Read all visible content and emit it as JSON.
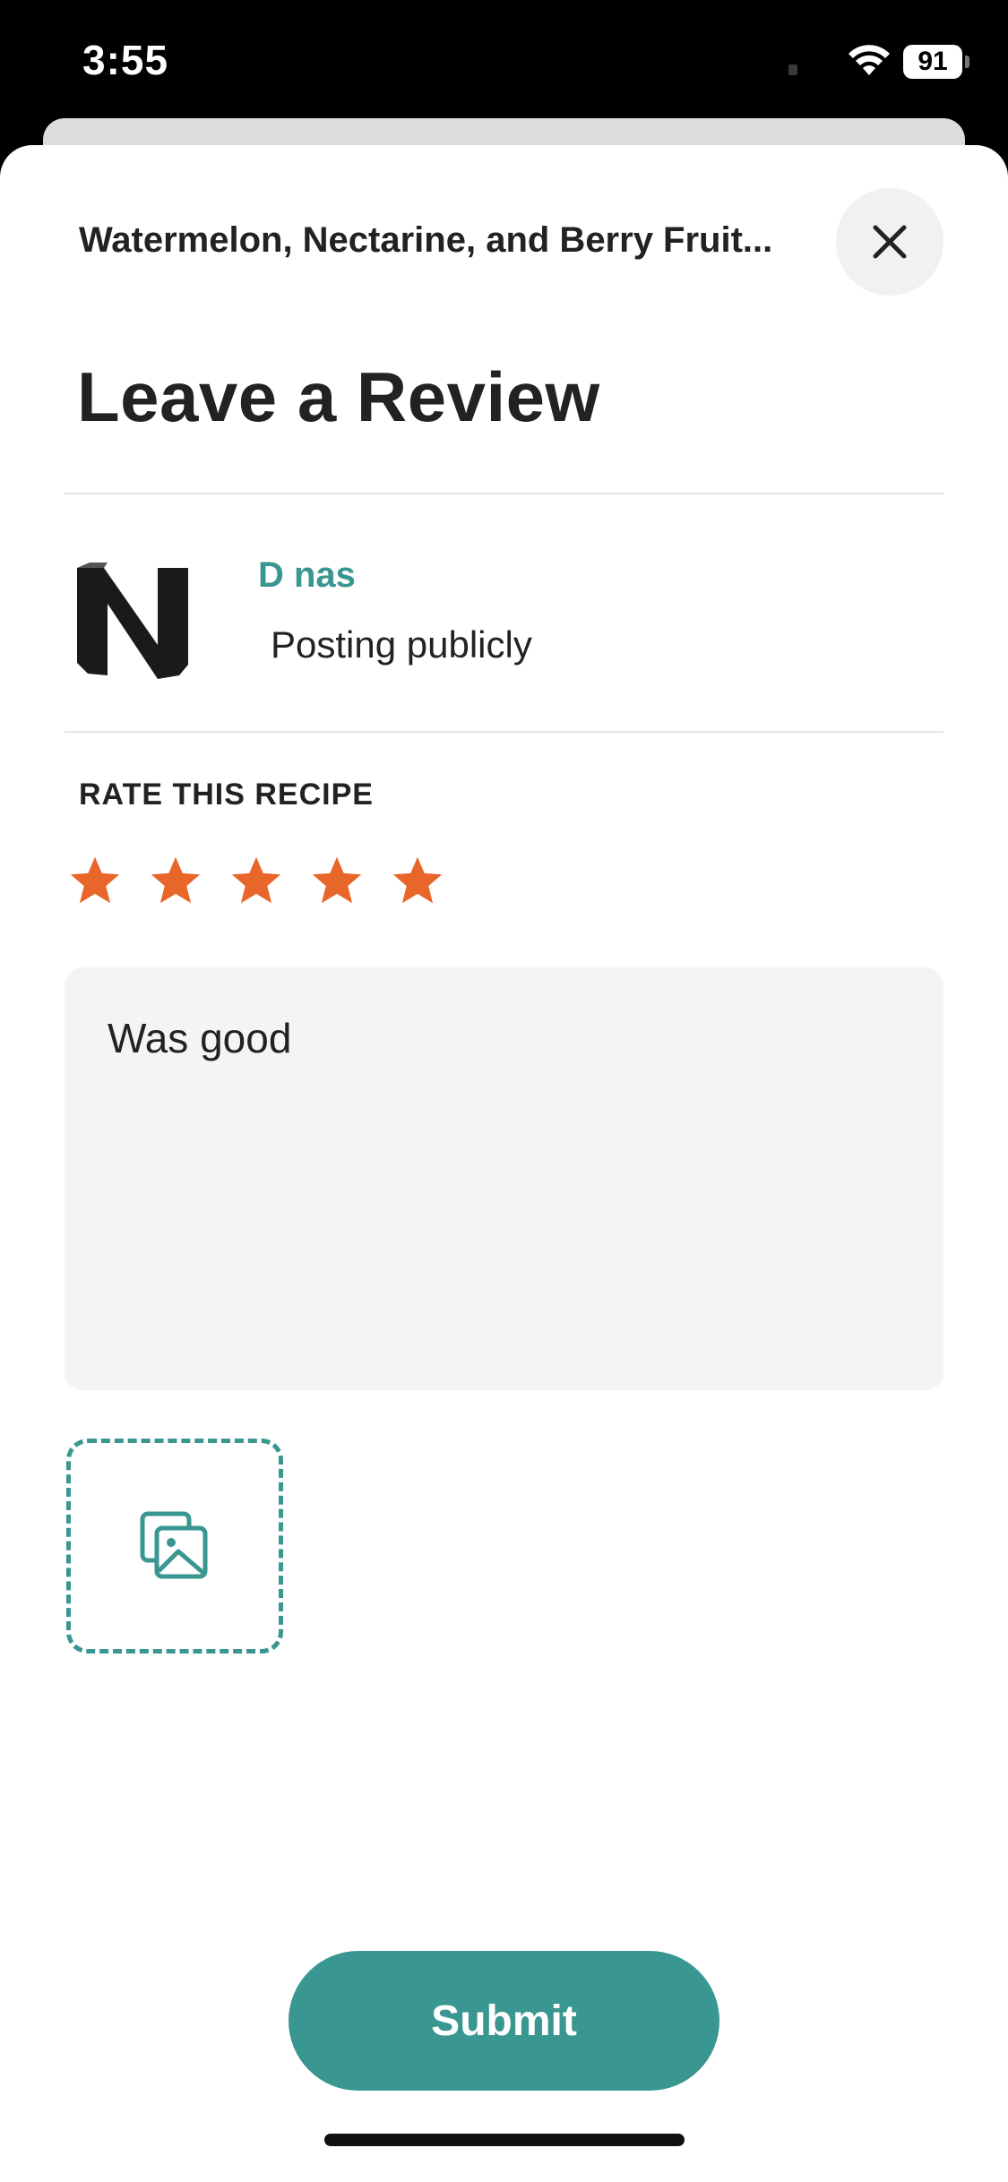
{
  "status_bar": {
    "time": "3:55",
    "battery": "91"
  },
  "header": {
    "recipe_title": "Watermelon, Nectarine, and Berry Fruit...",
    "close_icon": "close-icon"
  },
  "page": {
    "title": "Leave a Review"
  },
  "user": {
    "name": "D nas",
    "visibility": "Posting publicly"
  },
  "rating": {
    "label": "RATE THIS RECIPE",
    "value": 5,
    "max": 5,
    "star_color": "#e8662a"
  },
  "review": {
    "text": "Was good"
  },
  "photo": {
    "icon": "add-photo-icon"
  },
  "actions": {
    "submit_label": "Submit"
  },
  "colors": {
    "accent": "#3a9690",
    "star": "#e8662a"
  }
}
